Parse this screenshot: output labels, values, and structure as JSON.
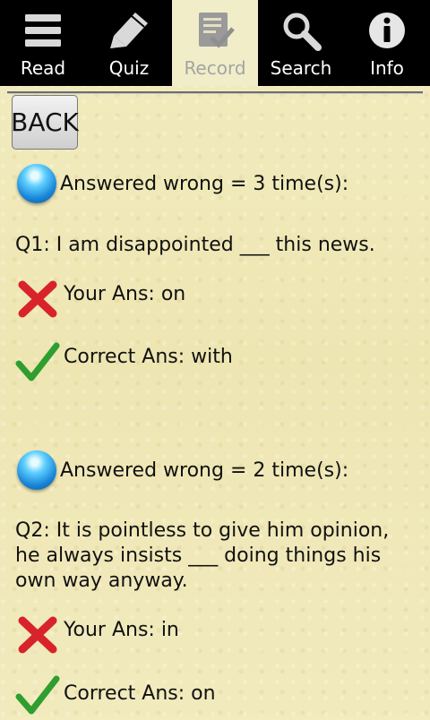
{
  "tabs": [
    {
      "label": "Read",
      "icon": "menu-lines-icon"
    },
    {
      "label": "Quiz",
      "icon": "pencil-icon"
    },
    {
      "label": "Record",
      "icon": "record-checklist-icon",
      "active": true
    },
    {
      "label": "Search",
      "icon": "search-icon"
    },
    {
      "label": "Info",
      "icon": "info-icon"
    }
  ],
  "back_label": "BACK",
  "records": [
    {
      "wrong_count_text": "Answered wrong = 3 time(s):",
      "question": "Q1: I am disappointed ___ this news.",
      "your_ans": "Your Ans: on",
      "correct_ans": "Correct Ans: with"
    },
    {
      "wrong_count_text": "Answered wrong = 2 time(s):",
      "question": "Q2: It is pointless to give him opinion, he always insists ___ doing things his own way anyway.",
      "your_ans": "Your Ans: in",
      "correct_ans": "Correct Ans: on"
    }
  ],
  "colors": {
    "active_tab_bg": "#f1edc8",
    "wrong_icon": "#d8232a",
    "correct_icon": "#2f9e2f",
    "orb": "#1a86d8"
  }
}
